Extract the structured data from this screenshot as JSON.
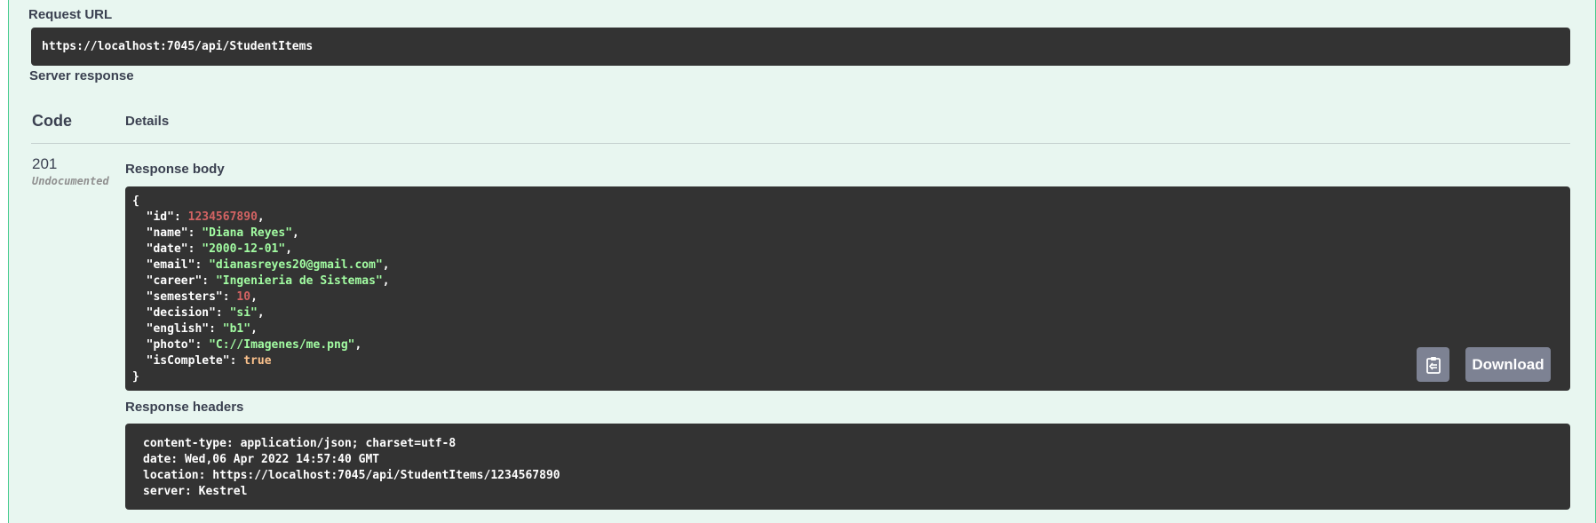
{
  "request": {
    "label": "Request URL",
    "url": "https://localhost:7045/api/StudentItems"
  },
  "server_response": {
    "label": "Server response",
    "columns": {
      "code": "Code",
      "details": "Details"
    },
    "status": {
      "code": "201",
      "doc": "Undocumented"
    },
    "body_label": "Response body",
    "body": {
      "open": "{",
      "close": "}",
      "fields": [
        {
          "key": "\"id\"",
          "value": "1234567890",
          "type": "number",
          "comma": ","
        },
        {
          "key": "\"name\"",
          "value": "\"Diana Reyes\"",
          "type": "string",
          "comma": ","
        },
        {
          "key": "\"date\"",
          "value": "\"2000-12-01\"",
          "type": "string",
          "comma": ","
        },
        {
          "key": "\"email\"",
          "value": "\"dianasreyes20@gmail.com\"",
          "type": "string",
          "comma": ","
        },
        {
          "key": "\"career\"",
          "value": "\"Ingenieria de Sistemas\"",
          "type": "string",
          "comma": ","
        },
        {
          "key": "\"semesters\"",
          "value": "10",
          "type": "number",
          "comma": ","
        },
        {
          "key": "\"decision\"",
          "value": "\"si\"",
          "type": "string",
          "comma": ","
        },
        {
          "key": "\"english\"",
          "value": "\"b1\"",
          "type": "string",
          "comma": ","
        },
        {
          "key": "\"photo\"",
          "value": "\"C://Imagenes/me.png\"",
          "type": "string",
          "comma": ","
        },
        {
          "key": "\"isComplete\"",
          "value": "true",
          "type": "boolean",
          "comma": ""
        }
      ]
    },
    "buttons": {
      "copy_icon": "clipboard-icon",
      "download": "Download"
    },
    "headers_label": "Response headers",
    "headers": [
      "content-type: application/json; charset=utf-8",
      "date: Wed,06 Apr 2022 14:57:40 GMT",
      "location: https://localhost:7045/api/StudentItems/1234567890",
      "server: Kestrel"
    ]
  },
  "colors": {
    "panel_bg": "#e8f6f0",
    "panel_border": "#49cc90",
    "code_bg": "#333333",
    "string": "#a2fca2",
    "number": "#d36363",
    "boolean": "#fcc28c",
    "button_bg": "#7d8293"
  }
}
